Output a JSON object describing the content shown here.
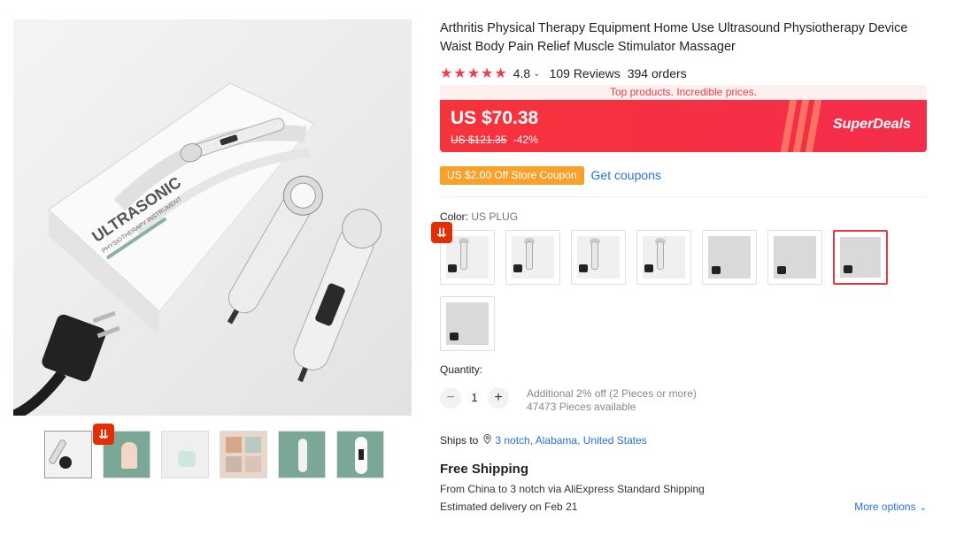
{
  "product": {
    "title": "Arthritis Physical Therapy Equipment Home Use Ultrasound Physiotherapy Device Waist Body Pain Relief Muscle Stimulator Massager",
    "image_text": {
      "box_brand": "ULTRASONIC",
      "box_subtitle": "PHYSIOTHERAPY INSTRUMENT"
    }
  },
  "rating": {
    "stars": "★★★★★",
    "value": "4.8",
    "chevron": "⌄",
    "reviews": "109 Reviews",
    "orders": "394 orders"
  },
  "promo": {
    "tag": "Top products. Incredible prices.",
    "price": "US $70.38",
    "old_price": "US $121.35",
    "discount": "-42%",
    "brand": "SuperDeals"
  },
  "coupon": {
    "label": "US $2.00 Off Store Coupon",
    "link": "Get coupons"
  },
  "color": {
    "label": "Color: ",
    "value": "US PLUG",
    "options_count": 8,
    "selected_index": 6
  },
  "quantity": {
    "label": "Quantity:",
    "minus": "−",
    "plus": "+",
    "value": "1",
    "note_discount": "Additional 2% off (2 Pieces or more)",
    "note_available": "47473 Pieces available"
  },
  "shipping": {
    "ships_to_label": "Ships to",
    "location": "3 notch, Alabama, United States",
    "method_title": "Free Shipping",
    "detail": "From China to 3 notch via AliExpress Standard Shipping",
    "delivery": "Estimated delivery on Feb 21",
    "more_options": "More options"
  },
  "badges": {
    "deal_glyph": "⇊"
  },
  "icons": {
    "star": "star-icon",
    "pin": "location-pin-icon",
    "deal": "deal-badge-icon"
  },
  "colors": {
    "accent": "#f23d4d",
    "link": "#2a6fdc",
    "coupon": "#f8a12c"
  }
}
